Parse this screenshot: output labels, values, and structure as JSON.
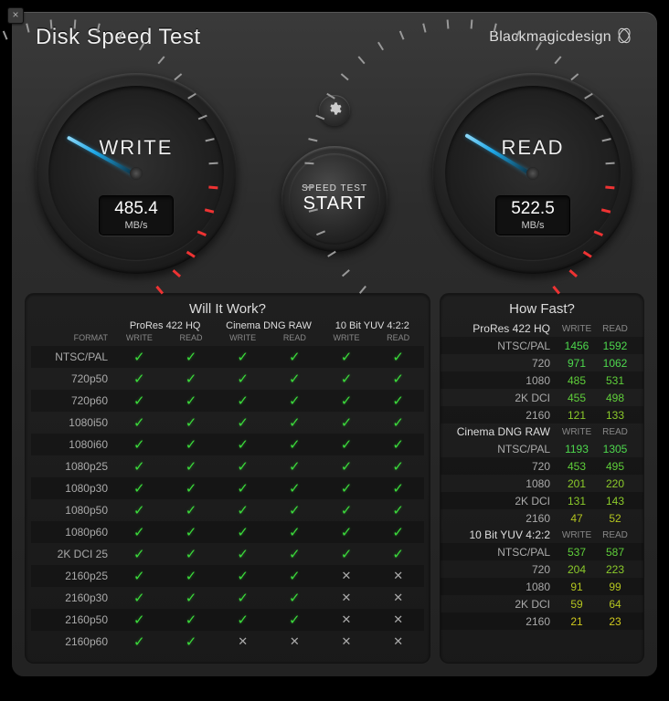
{
  "header": {
    "title": "Disk Speed Test",
    "brand": "Blackmagicdesign"
  },
  "gauges": {
    "write": {
      "label": "WRITE",
      "value": "485.4",
      "unit": "MB/s",
      "angle": -151
    },
    "read": {
      "label": "READ",
      "value": "522.5",
      "unit": "MB/s",
      "angle": -149
    }
  },
  "center": {
    "sub": "SPEED TEST",
    "main": "START"
  },
  "willwork": {
    "title": "Will It Work?",
    "format_label": "FORMAT",
    "groups": [
      "ProRes 422 HQ",
      "Cinema DNG RAW",
      "10 Bit YUV 4:2:2"
    ],
    "subcols": [
      "WRITE",
      "READ",
      "WRITE",
      "READ",
      "WRITE",
      "READ"
    ],
    "rows": [
      {
        "label": "NTSC/PAL",
        "cells": [
          1,
          1,
          1,
          1,
          1,
          1
        ]
      },
      {
        "label": "720p50",
        "cells": [
          1,
          1,
          1,
          1,
          1,
          1
        ]
      },
      {
        "label": "720p60",
        "cells": [
          1,
          1,
          1,
          1,
          1,
          1
        ]
      },
      {
        "label": "1080i50",
        "cells": [
          1,
          1,
          1,
          1,
          1,
          1
        ]
      },
      {
        "label": "1080i60",
        "cells": [
          1,
          1,
          1,
          1,
          1,
          1
        ]
      },
      {
        "label": "1080p25",
        "cells": [
          1,
          1,
          1,
          1,
          1,
          1
        ]
      },
      {
        "label": "1080p30",
        "cells": [
          1,
          1,
          1,
          1,
          1,
          1
        ]
      },
      {
        "label": "1080p50",
        "cells": [
          1,
          1,
          1,
          1,
          1,
          1
        ]
      },
      {
        "label": "1080p60",
        "cells": [
          1,
          1,
          1,
          1,
          1,
          1
        ]
      },
      {
        "label": "2K DCI 25",
        "cells": [
          1,
          1,
          1,
          1,
          1,
          1
        ]
      },
      {
        "label": "2160p25",
        "cells": [
          1,
          1,
          1,
          1,
          0,
          0
        ]
      },
      {
        "label": "2160p30",
        "cells": [
          1,
          1,
          1,
          1,
          0,
          0
        ]
      },
      {
        "label": "2160p50",
        "cells": [
          1,
          1,
          1,
          1,
          0,
          0
        ]
      },
      {
        "label": "2160p60",
        "cells": [
          1,
          1,
          0,
          0,
          0,
          0
        ]
      }
    ]
  },
  "howfast": {
    "title": "How Fast?",
    "subcols": [
      "WRITE",
      "READ"
    ],
    "sections": [
      {
        "name": "ProRes 422 HQ",
        "rows": [
          {
            "label": "NTSC/PAL",
            "write": "1456",
            "read": "1592",
            "cw": "g0",
            "cr": "g0"
          },
          {
            "label": "720",
            "write": "971",
            "read": "1062",
            "cw": "g0",
            "cr": "g0"
          },
          {
            "label": "1080",
            "write": "485",
            "read": "531",
            "cw": "g1",
            "cr": "g1"
          },
          {
            "label": "2K DCI",
            "write": "455",
            "read": "498",
            "cw": "g1",
            "cr": "g1"
          },
          {
            "label": "2160",
            "write": "121",
            "read": "133",
            "cw": "g2",
            "cr": "g2"
          }
        ]
      },
      {
        "name": "Cinema DNG RAW",
        "rows": [
          {
            "label": "NTSC/PAL",
            "write": "1193",
            "read": "1305",
            "cw": "g0",
            "cr": "g0"
          },
          {
            "label": "720",
            "write": "453",
            "read": "495",
            "cw": "g1",
            "cr": "g1"
          },
          {
            "label": "1080",
            "write": "201",
            "read": "220",
            "cw": "g2",
            "cr": "g2"
          },
          {
            "label": "2K DCI",
            "write": "131",
            "read": "143",
            "cw": "g2",
            "cr": "g2"
          },
          {
            "label": "2160",
            "write": "47",
            "read": "52",
            "cw": "g3",
            "cr": "g3"
          }
        ]
      },
      {
        "name": "10 Bit YUV 4:2:2",
        "rows": [
          {
            "label": "NTSC/PAL",
            "write": "537",
            "read": "587",
            "cw": "g1",
            "cr": "g1"
          },
          {
            "label": "720",
            "write": "204",
            "read": "223",
            "cw": "g2",
            "cr": "g2"
          },
          {
            "label": "1080",
            "write": "91",
            "read": "99",
            "cw": "g3",
            "cr": "g3"
          },
          {
            "label": "2K DCI",
            "write": "59",
            "read": "64",
            "cw": "g3",
            "cr": "g3"
          },
          {
            "label": "2160",
            "write": "21",
            "read": "23",
            "cw": "g4",
            "cr": "g4"
          }
        ]
      }
    ]
  }
}
